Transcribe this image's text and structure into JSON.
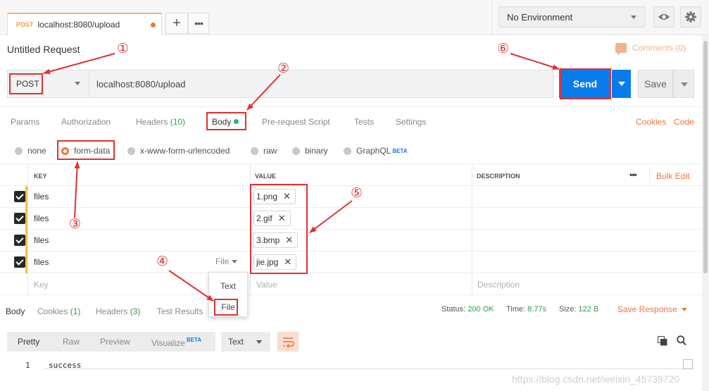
{
  "tab": {
    "method": "POST",
    "url": "localhost:8080/upload",
    "add_label": "+",
    "more_label": "•••"
  },
  "environment": {
    "selected": "No Environment"
  },
  "request": {
    "title": "Untitled Request",
    "comments": "Comments (0)",
    "method": "POST",
    "url": "localhost:8080/upload",
    "send_label": "Send",
    "save_label": "Save"
  },
  "request_tabs": [
    {
      "label": "Params"
    },
    {
      "label": "Authorization"
    },
    {
      "label": "Headers",
      "count": "(10)"
    },
    {
      "label": "Body"
    },
    {
      "label": "Pre-request Script"
    },
    {
      "label": "Tests"
    },
    {
      "label": "Settings"
    }
  ],
  "links": {
    "cookies": "Cookies",
    "code": "Code"
  },
  "body_modes": [
    {
      "label": "none"
    },
    {
      "label": "form-data",
      "selected": true
    },
    {
      "label": "x-www-form-urlencoded"
    },
    {
      "label": "raw"
    },
    {
      "label": "binary"
    },
    {
      "label": "GraphQL",
      "badge": "BETA"
    }
  ],
  "table": {
    "headers": {
      "key": "KEY",
      "value": "VALUE",
      "description": "DESCRIPTION",
      "more": "•••",
      "bulk_edit": "Bulk Edit"
    },
    "rows": [
      {
        "key": "files",
        "file": "1.png"
      },
      {
        "key": "files",
        "file": "2.gif"
      },
      {
        "key": "files",
        "file": "3.bmp"
      },
      {
        "key": "files",
        "file": "jie.jpg",
        "type": "File"
      }
    ],
    "placeholders": {
      "key": "Key",
      "value": "Value",
      "description": "Description"
    }
  },
  "type_popup": {
    "options": [
      "Text",
      "File"
    ]
  },
  "response": {
    "tabs": [
      {
        "label": "Body"
      },
      {
        "label": "Cookies",
        "count": "(1)"
      },
      {
        "label": "Headers",
        "count": "(3)"
      },
      {
        "label": "Test Results"
      }
    ],
    "status_label": "Status:",
    "status": "200 OK",
    "time_label": "Time:",
    "time": "8.77s",
    "size_label": "Size:",
    "size": "122 B",
    "save_response": "Save Response",
    "views": [
      "Pretty",
      "Raw",
      "Preview",
      "Visualize"
    ],
    "visualize_badge": "BETA",
    "format": "Text",
    "line_number": "1",
    "content": "success"
  },
  "annotations": [
    "①",
    "②",
    "③",
    "④",
    "⑤",
    "⑥"
  ],
  "watermark": "https://blog.csdn.net/weixin_45739720",
  "colors": {
    "accent": "#f0753b",
    "send": "#097bed",
    "annotation": "#e03131",
    "count_green": "#2aa04a"
  }
}
